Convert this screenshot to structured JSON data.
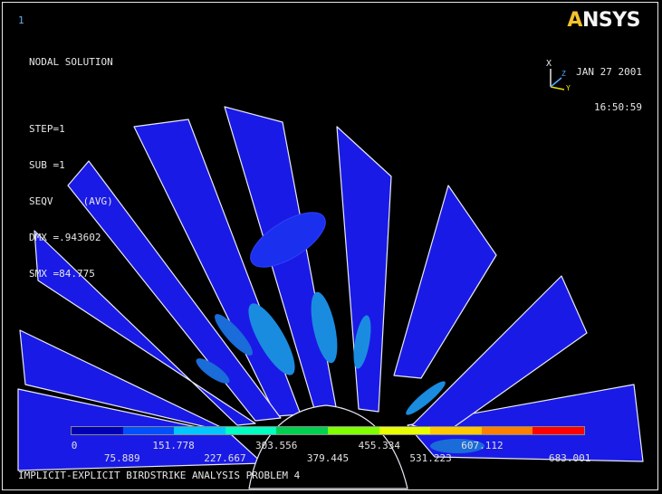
{
  "window": {
    "number": "1"
  },
  "logo": {
    "a_char": "A",
    "rest": "NSYS"
  },
  "info": {
    "title": "NODAL SOLUTION",
    "step": "STEP=1",
    "sub": "SUB =1",
    "seqv": "SEQV     (AVG)",
    "dmx": "DMX =.943602",
    "smx": "SMX =84.775"
  },
  "stamp": {
    "date": "JAN 27 2001",
    "time": "16:50:59"
  },
  "triad": {
    "x_label": "X",
    "y_label": "Y",
    "z_label": "Z"
  },
  "legend": {
    "colors": [
      "#0000b4",
      "#0050ff",
      "#00c8ff",
      "#00ffc0",
      "#00d050",
      "#80ff00",
      "#e8ff00",
      "#ffc800",
      "#ff8000",
      "#ff0000"
    ],
    "top_labels": [
      "0",
      "151.778",
      "303.556",
      "455.334",
      "607.112"
    ],
    "bottom_labels": [
      "75.889",
      "227.667",
      "379.445",
      "531.223",
      "683.001"
    ]
  },
  "footer": {
    "title": "IMPLICIT-EXPLICIT BIRDSTRIKE ANALYSIS PROBLEM 4"
  }
}
